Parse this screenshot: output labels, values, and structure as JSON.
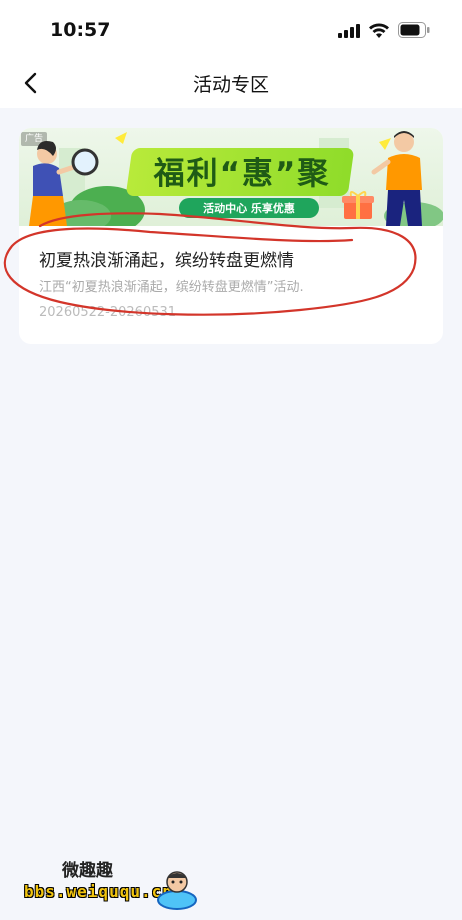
{
  "status_bar": {
    "time": "10:57",
    "icons": [
      "signal-icon",
      "wifi-icon",
      "battery-icon"
    ]
  },
  "nav": {
    "title": "活动专区",
    "back_icon": "chevron-left-icon"
  },
  "activity": {
    "ad_tag": "广告",
    "banner_title": "福利“惠”聚",
    "banner_subtitle": "活动中心 乐享优惠",
    "title": "初夏热浪渐涌起，缤纷转盘更燃情",
    "description": "江西“初夏热浪渐涌起，缤纷转盘更燃情”活动.",
    "date_range": "20260522-20260531"
  },
  "annotation": {
    "color": "#d3352a"
  },
  "watermark": {
    "title": "微趣趣",
    "url": "bbs.weiququ.cn"
  },
  "colors": {
    "background": "#f4f6fb",
    "banner_green": "#a6e23a",
    "banner_text": "#1f5b16"
  }
}
